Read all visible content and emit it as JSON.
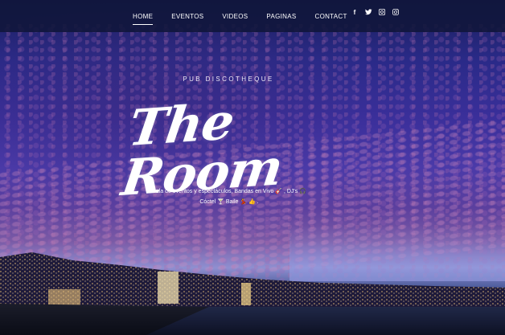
{
  "nav": {
    "items": [
      {
        "label": "HOME",
        "active": true
      },
      {
        "label": "EVENTOS",
        "active": false
      },
      {
        "label": "VIDEOS",
        "active": false
      },
      {
        "label": "PAGINAS",
        "active": false
      },
      {
        "label": "CONTACT",
        "active": false
      }
    ],
    "social": [
      {
        "name": "facebook-icon",
        "glyph": "f"
      },
      {
        "name": "twitter-icon",
        "glyph": "🐦"
      },
      {
        "name": "gplus-icon",
        "glyph": "⊕"
      },
      {
        "name": "instagram-icon",
        "glyph": "◎"
      }
    ]
  },
  "hero": {
    "eyebrow": "PUB DISCOTHEQUE",
    "title": "The Room",
    "tagline_line1": "Sala de eventos y espectáculos, Bandas en Vivo 🎸 , DJ's 🎧",
    "tagline_line2": "Cóctel 🍸 Baile 💃 👍 ."
  },
  "colors": {
    "nav_bg": "#10163a",
    "sky_top": "#1a1f5c",
    "sky_mid": "#4a3aa8",
    "accent_pink": "#c07ab0"
  }
}
